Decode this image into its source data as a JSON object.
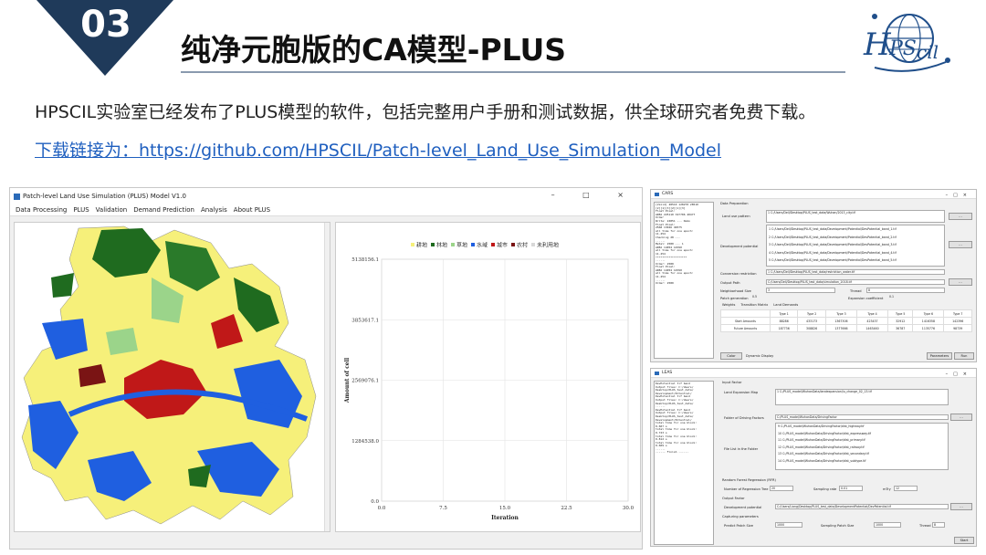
{
  "header": {
    "number": "03",
    "title": "纯净元胞版的CA模型-PLUS",
    "logo_text": "HPSCIL"
  },
  "intro": "HPSCIL实验室已经发布了PLUS模型的软件，包括完整用户手册和测试数据，供全球研究者免费下载。",
  "link": "下载链接为：https://github.com/HPSCIL/Patch-level_Land_Use_Simulation_Model",
  "main_window": {
    "title": "Patch-level Land Use Simulation (PLUS) Model V1.0",
    "controls": "– □ ×",
    "menu": [
      "Data Processing",
      "PLUS",
      "Validation",
      "Demand Prediction",
      "Analysis",
      "About PLUS"
    ]
  },
  "colors": {
    "cropland": "#f6f07a",
    "forest": "#1f6b1f",
    "grassland": "#9bd48a",
    "water": "#1f5fe0",
    "urban": "#c01818",
    "rural": "#7a1414",
    "unused": "#d8d8d8",
    "header_dark": "#1f3a5a"
  },
  "chart_data": {
    "type": "line",
    "legend": [
      "耕地",
      "林地",
      "草地",
      "水域",
      "城市",
      "农村",
      "未利用地"
    ],
    "xlabel": "Iteration",
    "ylabel": "Amount of cell",
    "x_ticks": [
      "0.0",
      "7.5",
      "15.0",
      "22.5",
      "30.0"
    ],
    "y_ticks": [
      "0.0",
      "1284538.0",
      "2569076.1",
      "3853617.1",
      "5138156.1"
    ],
    "xlim": [
      0,
      30
    ],
    "ylim": [
      0,
      5138156.1
    ],
    "series": []
  },
  "caws": {
    "title": "CARS",
    "console": "[Valid] 28510 128270 28510\n[2][1][3][2][1][3]\nFloat Pixel:\nAREA 225110 347706 40477\nOrder\nWrite: 24851 --- Demo\nFloat Pixel:\n2568 13046 49575\nall time for one epoch:\n11.454\nChecking 28 ---\n......\nMetal: 2580 --- 1\nAREA 14054 14590\nall time for one epoch:\n11.454\n*******************\n......\nOrder: 2580\nFloat Pixel:\nAREA 14054 14590\nall time for one epoch:\n11.454\n......\nOrder: 2580",
    "section": "Data Preparation",
    "land_use_label": "Land  use  pattern",
    "land_use_path": "1  C:/Users/Dell/Desktop/PLUS_test_data/Wuhan/2013_city.tif",
    "dev_label": "Development potential",
    "dev_paths": [
      "1  C:/Users/Dell/Desktop/PLUS_test_data/Development/Potential/DevPotential_band_1.tif",
      "2  C:/Users/Dell/Desktop/PLUS_test_data/Development/Potential/DevPotential_band_2.tif",
      "3  C:/Users/Dell/Desktop/PLUS_test_data/Development/Potential/DevPotential_band_3.tif",
      "4  C:/Users/Dell/Desktop/PLUS_test_data/Development/Potential/DevPotential_band_4.tif",
      "5  C:/Users/Dell/Desktop/PLUS_test_data/Development/Potential/DevPotential_band_5.tif"
    ],
    "restriction_label": "Conversion restriction",
    "restriction_path": "1  C:/Users/Dell/Desktop/PLUS_test_data/restriction_water.tif",
    "output_label": "Output Path",
    "output_path": "C:/Users/Dell/Desktop/PLUS_test_data/simulation_2018.tif",
    "neighborhood_label": "Neighborhood Size",
    "neighborhood_value": "3",
    "thread_label": "Thread",
    "thread_value": "8",
    "patch_label": "Patch generation",
    "patch_value": "0.5",
    "expansion_label": "Expansion coefficient",
    "expansion_value": "0.1",
    "tabs": [
      "Weights",
      "Transition Matrix",
      "Land Demands"
    ],
    "types": [
      "Type 1",
      "Type 2",
      "Type 3",
      "Type 4",
      "Type 5",
      "Type 6",
      "Type 7"
    ],
    "start_label": "Start Amounts",
    "future_label": "Future Amounts",
    "start": [
      "88286",
      "433173",
      "1367306",
      "423437",
      "32912",
      "1416358",
      "142396"
    ],
    "future": [
      "187736",
      "308826",
      "1377666",
      "1463460",
      "36787",
      "1135776",
      "98739"
    ],
    "btn_color": "Color",
    "btn_display": "Dynamic Display",
    "btn_params": "Parameters",
    "btn_run": "Run"
  },
  "leas": {
    "title": "LEAS",
    "console": "DevPotential tif band\nOutput files: C:/Users/\nDesktop/PLUS_test_data/\nDevelopment/Potential/\nDevPotential tif band\nOutput files: C:/Users/\nDesktop/PLUS_test_data/\n......\nDevPotential tif band\nOutput files: C:/Users/\nDesktop/PLUS_test_data/\nDevelopment/Potential/\ntotal time for one block:\n0.607 s\ntotal time for one block:\n0.723 s\ntotal time for one block:\n0.812 s\ntotal time for one block:\n0.609 s\n......\n------ Finish ------",
    "section": "Input Factor",
    "land_label": "Land  Expansion  Map",
    "land_path": "1  C:/PLUS_model/WuhanData/landexpansion/lu_change_02_13.tif",
    "folder_label": "Folder of Driving Factors",
    "folder_path": "C:/PLUS_model/WuhanData/DrivingFactor",
    "file_label": "File List in the Folder",
    "files": [
      "9  C:/PLUS_model/WuhanData/DrivingFactor/dist_highway.tif",
      "10  C:/PLUS_model/WuhanData/DrivingFactor/dist_expressway.tif",
      "11  C:/PLUS_model/WuhanData/DrivingFactor/dist_primary.tif",
      "12  C:/PLUS_model/WuhanData/DrivingFactor/dist_railway.tif",
      "13  C:/PLUS_model/WuhanData/DrivingFactor/dist_secondary.tif",
      "14  C:/PLUS_model/WuhanData/DrivingFactor/dist_subtype.tif"
    ],
    "rf_label": "Random Forest Regression (RFR)",
    "trees_label": "Number of Regression Tree",
    "trees_value": "20",
    "sampling_label": "Sampling rate",
    "sampling_value": "0.01",
    "mtry_label": "mTry",
    "mtry_value": "12",
    "output_label": "Output Factor",
    "dev_label": "Development potential",
    "dev_path": "C:/Users/Liang/Desktop/PLUS_test_data/DevelopmentPotential/DevPotential.tif",
    "cap_label": "Capturing parameters",
    "patch_size_label": "Predict Patch Size",
    "patch_size_value": "1000",
    "sampling_patch_label": "Sampling Patch Size",
    "sampling_patch_value": "1000",
    "thread_label": "Thread",
    "thread_value": "8",
    "btn_start": "Start"
  }
}
